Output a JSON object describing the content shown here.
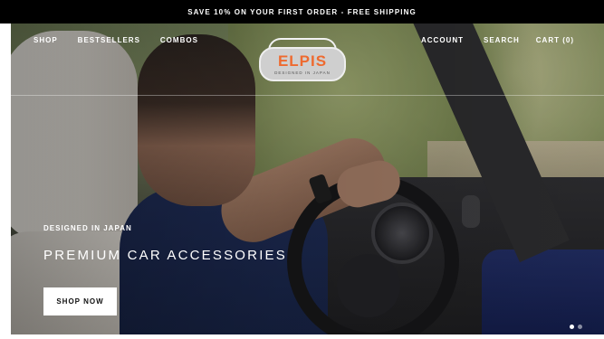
{
  "announcement": {
    "text": "SAVE 10% ON YOUR FIRST ORDER - FREE SHIPPING"
  },
  "nav": {
    "left": [
      "SHOP",
      "BESTSELLERS",
      "COMBOS"
    ],
    "right": {
      "account": "ACCOUNT",
      "search": "SEARCH",
      "cart": "CART (0)"
    }
  },
  "logo": {
    "word": "ELPIS",
    "tagline": "DESIGNED IN JAPAN"
  },
  "hero": {
    "eyebrow": "DESIGNED IN JAPAN",
    "headline": "PREMIUM CAR ACCESSORIES",
    "cta": "SHOP NOW"
  },
  "colors": {
    "announcement_bg": "#000000",
    "logo_accent": "#ee6a2f",
    "button_bg": "#ffffff"
  },
  "icons": [
    "car-logo-icon",
    "slideshow-dots-icon"
  ]
}
